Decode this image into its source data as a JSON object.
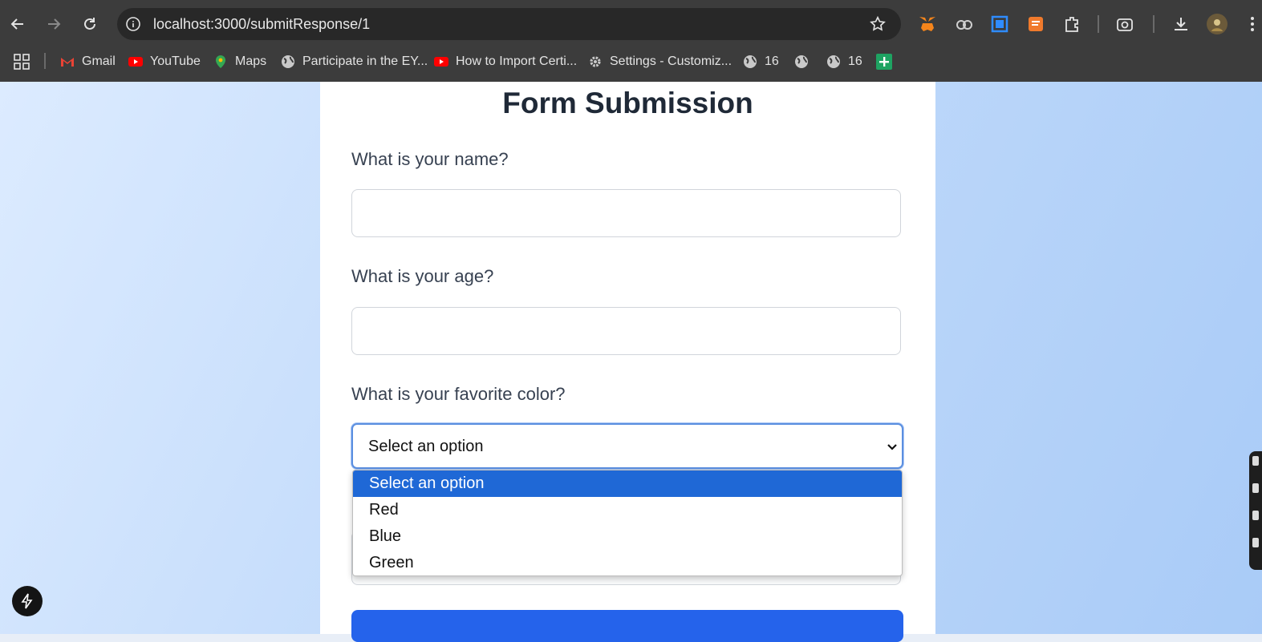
{
  "browser": {
    "url": "localhost:3000/submitResponse/1",
    "bookmarks": [
      {
        "label": "Gmail",
        "icon": "gmail-icon"
      },
      {
        "label": "YouTube",
        "icon": "youtube-icon"
      },
      {
        "label": "Maps",
        "icon": "maps-icon"
      },
      {
        "label": "Participate in the EY...",
        "icon": "globe-icon"
      },
      {
        "label": "How to Import Certi...",
        "icon": "youtube-icon"
      },
      {
        "label": "Settings - Customiz...",
        "icon": "gear-icon"
      },
      {
        "label": "16",
        "icon": "globe-icon"
      },
      {
        "label": "",
        "icon": "globe-icon"
      },
      {
        "label": "16",
        "icon": "globe-icon"
      }
    ],
    "extensions": [
      "metamask-icon",
      "cloud-link-icon",
      "screen-capture-icon",
      "notes-icon",
      "puzzle-icon",
      "camera-search-icon",
      "download-icon",
      "profile-avatar"
    ]
  },
  "form": {
    "title": "Form Submission",
    "questions": [
      {
        "label": "What is your name?",
        "value": ""
      },
      {
        "label": "What is your age?",
        "value": ""
      },
      {
        "label": "What is your favorite color?",
        "selected": "Select an option"
      }
    ],
    "dropdown_options": [
      "Select an option",
      "Red",
      "Blue",
      "Green"
    ]
  },
  "colors": {
    "accent": "#2563eb",
    "highlight": "#1f68d6",
    "chrome": "#3c3c3c"
  }
}
